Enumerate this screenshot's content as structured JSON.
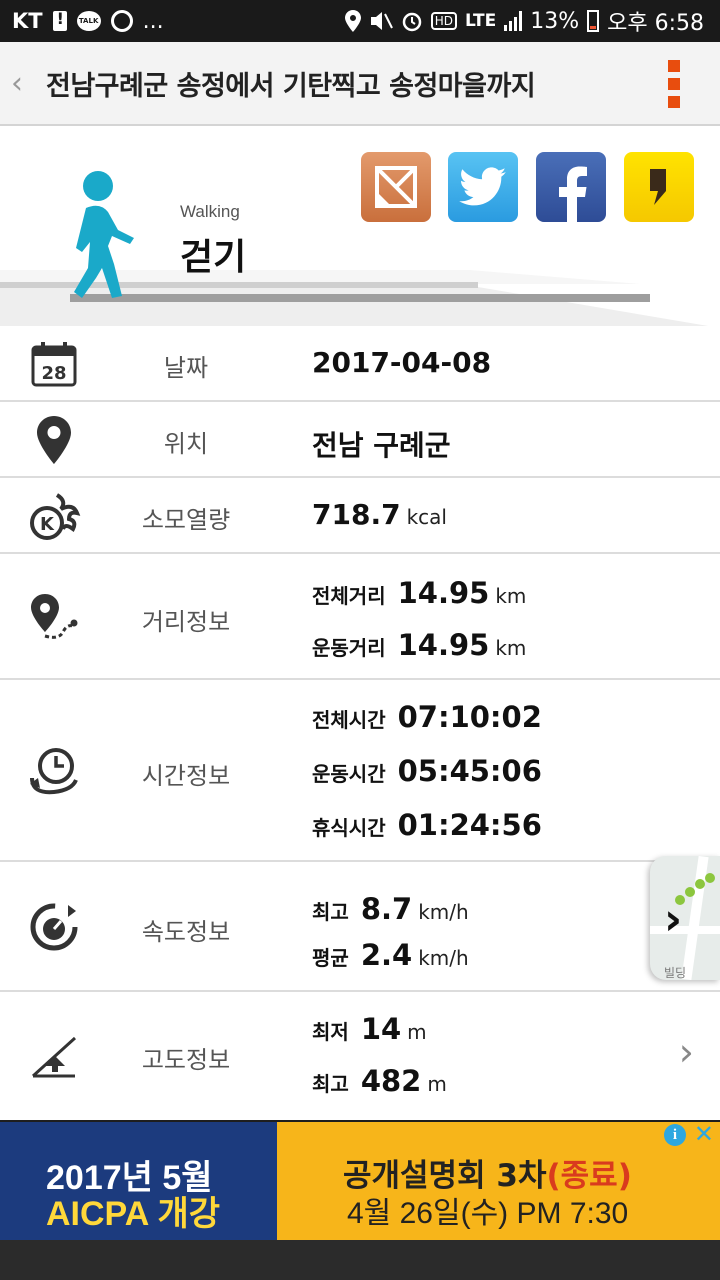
{
  "status_bar": {
    "carrier": "KT",
    "notif_more": "...",
    "network": "LTE",
    "battery": "13%",
    "time": "오후 6:58"
  },
  "app_bar": {
    "title": "전남구례군 송정에서 기탄찍고 송정마을까지"
  },
  "activity": {
    "type_en": "Walking",
    "type_ko": "걷기"
  },
  "share_icons": [
    "kakaostory-icon",
    "twitter-icon",
    "facebook-icon",
    "kakaotalk-icon"
  ],
  "rows": {
    "date": {
      "label": "날짜",
      "value": "2017-04-08",
      "icon_day": "28"
    },
    "location": {
      "label": "위치",
      "value": "전남 구례군"
    },
    "calories": {
      "label": "소모열량",
      "value": "718.7",
      "unit": "kcal"
    },
    "distance": {
      "label": "거리정보",
      "total_label": "전체거리",
      "total_value": "14.95",
      "total_unit": "km",
      "moving_label": "운동거리",
      "moving_value": "14.95",
      "moving_unit": "km"
    },
    "time": {
      "label": "시간정보",
      "total_label": "전체시간",
      "total_value": "07:10:02",
      "moving_label": "운동시간",
      "moving_value": "05:45:06",
      "rest_label": "휴식시간",
      "rest_value": "01:24:56"
    },
    "speed": {
      "label": "속도정보",
      "max_label": "최고",
      "max_value": "8.7",
      "max_unit": "km/h",
      "avg_label": "평균",
      "avg_value": "2.4",
      "avg_unit": "km/h"
    },
    "altitude": {
      "label": "고도정보",
      "min_label": "최저",
      "min_value": "14",
      "min_unit": "m",
      "max_label": "최고",
      "max_value": "482",
      "max_unit": "m"
    }
  },
  "map_thumb": {
    "text1": "빌딩"
  },
  "ad": {
    "left_line1": "2017년 5월",
    "left_line2": "AICPA 개강",
    "right_line1": "공개설명회 3차",
    "right_line1_red": "(종료)",
    "right_line2": "4월 26일(수) PM 7:30",
    "info": "i",
    "close": "✕"
  }
}
